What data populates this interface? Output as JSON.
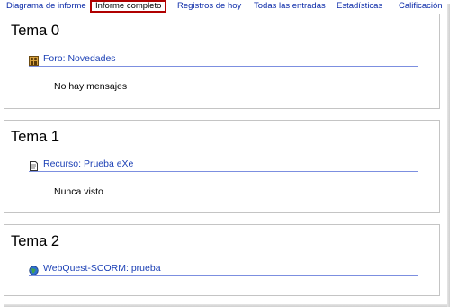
{
  "tabs": [
    {
      "label": "Diagrama de informe",
      "active": false
    },
    {
      "label": "Informe completo",
      "active": true
    },
    {
      "label": "Registros de hoy",
      "active": false
    },
    {
      "label": "Todas las entradas",
      "active": false
    },
    {
      "label": "Estadísticas",
      "active": false
    },
    {
      "label": "Calificación",
      "active": false
    }
  ],
  "sections": [
    {
      "title": "Tema 0",
      "activity": {
        "type_label": "Foro:",
        "name": "Novedades",
        "icon": "forum-icon"
      },
      "status": "No hay mensajes"
    },
    {
      "title": "Tema 1",
      "activity": {
        "type_label": "Recurso:",
        "name": "Prueba eXe",
        "icon": "resource-icon"
      },
      "status": "Nunca visto"
    },
    {
      "title": "Tema 2",
      "activity": {
        "type_label": "WebQuest-SCORM:",
        "name": "prueba",
        "icon": "webquest-icon"
      },
      "status": ""
    }
  ],
  "colors": {
    "link": "#1a3fb5",
    "active_tab_border": "#b00000",
    "section_border": "#c4c4c4",
    "activity_underline": "#7c8fe0"
  }
}
